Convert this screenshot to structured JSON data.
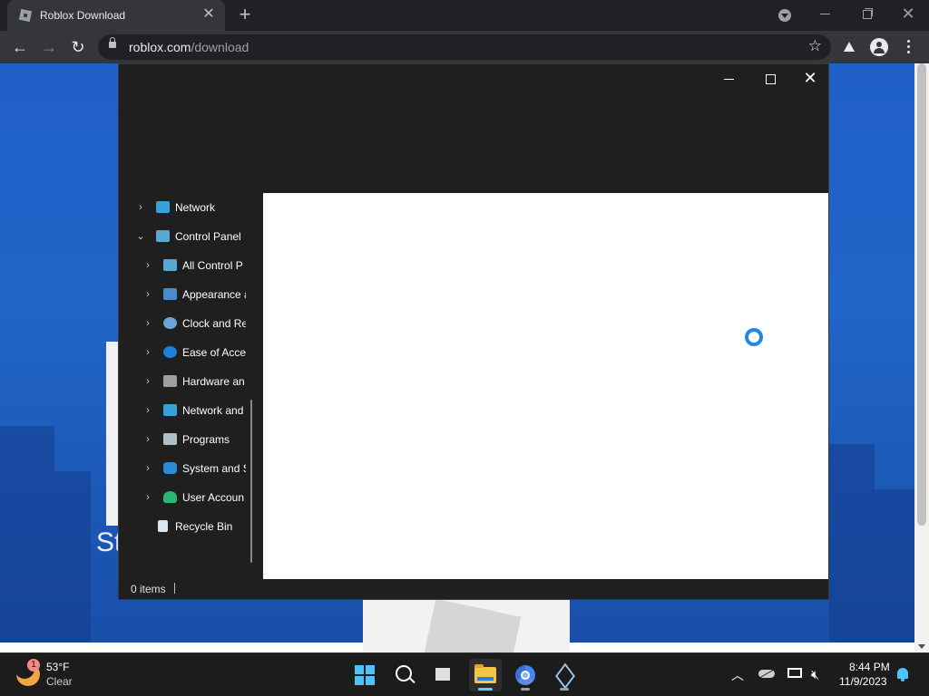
{
  "browser": {
    "tab_title": "Roblox Download",
    "tab_close": "✕",
    "new_tab": "+",
    "url_host": "roblox.com",
    "url_path": "/download",
    "back": "←",
    "forward": "→",
    "reload": "↻",
    "bookmark": "☆"
  },
  "page": {
    "partial_heading": "St"
  },
  "explorer": {
    "close": "✕",
    "nav_items": [
      {
        "label": "Network",
        "chevron": "›",
        "expanded": false
      },
      {
        "label": "Control Panel",
        "chevron": "⌄",
        "expanded": true
      },
      {
        "label": "All Control P",
        "chevron": "›"
      },
      {
        "label": "Appearance a",
        "chevron": "›"
      },
      {
        "label": "Clock and Re",
        "chevron": "›"
      },
      {
        "label": "Ease of Acce",
        "chevron": "›"
      },
      {
        "label": "Hardware an",
        "chevron": "›"
      },
      {
        "label": "Network and",
        "chevron": "›"
      },
      {
        "label": "Programs",
        "chevron": "›"
      },
      {
        "label": "System and S",
        "chevron": "›"
      },
      {
        "label": "User Accoun",
        "chevron": "›"
      },
      {
        "label": "Recycle Bin",
        "chevron": ""
      }
    ],
    "status_items": "0 items"
  },
  "taskbar": {
    "weather_temp": "53°F",
    "weather_cond": "Clear",
    "weather_badge": "1",
    "tray_chevron": "︿",
    "time": "8:44 PM",
    "date": "11/9/2023",
    "apps": [
      "start",
      "search",
      "task-view",
      "file-explorer",
      "chrome",
      "virtualbox"
    ]
  },
  "colors": {
    "accent": "#4cc2ff",
    "page_blue": "#2166c9",
    "spinner": "#1e88e5"
  }
}
